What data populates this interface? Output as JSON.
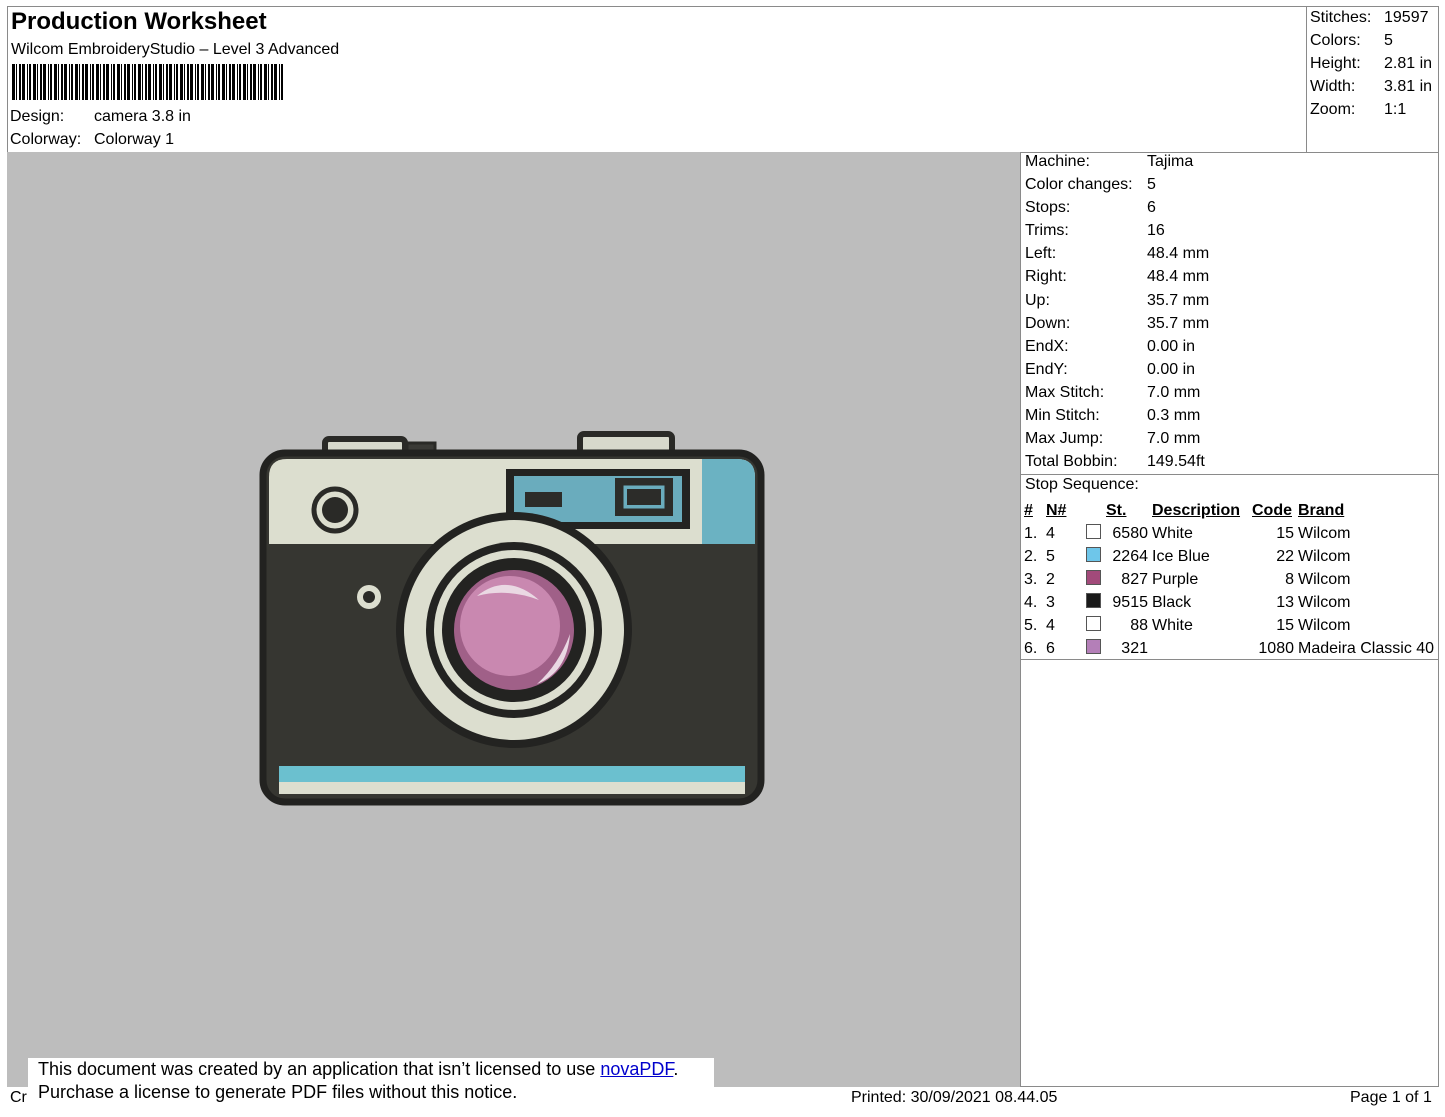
{
  "header": {
    "title": "Production Worksheet",
    "software": "Wilcom EmbroideryStudio – Level 3 Advanced",
    "design_label": "Design:",
    "design_value": "camera 3.8 in",
    "colorway_label": "Colorway:",
    "colorway_value": "Colorway 1"
  },
  "stats": [
    {
      "label": "Stitches:",
      "value": "19597"
    },
    {
      "label": "Colors:",
      "value": "5"
    },
    {
      "label": "Height:",
      "value": "2.81 in"
    },
    {
      "label": "Width:",
      "value": "3.81 in"
    },
    {
      "label": "Zoom:",
      "value": "1:1"
    }
  ],
  "specs": [
    {
      "label": "Machine:",
      "value": "Tajima"
    },
    {
      "label": "Color changes:",
      "value": "5"
    },
    {
      "label": "Stops:",
      "value": "6"
    },
    {
      "label": "Trims:",
      "value": "16"
    },
    {
      "label": "Left:",
      "value": "48.4 mm"
    },
    {
      "label": "Right:",
      "value": "48.4 mm"
    },
    {
      "label": "Up:",
      "value": "35.7 mm"
    },
    {
      "label": "Down:",
      "value": "35.7 mm"
    },
    {
      "label": "EndX:",
      "value": "0.00 in"
    },
    {
      "label": "EndY:",
      "value": "0.00 in"
    },
    {
      "label": "Max Stitch:",
      "value": "7.0 mm"
    },
    {
      "label": "Min Stitch:",
      "value": "0.3 mm"
    },
    {
      "label": "Max Jump:",
      "value": "7.0 mm"
    },
    {
      "label": "Total Bobbin:",
      "value": "149.54ft"
    }
  ],
  "stop_sequence": {
    "title": "Stop Sequence:",
    "headers": {
      "num": "#",
      "needle": "N#",
      "stitches": "St.",
      "description": "Description",
      "code": "Code",
      "brand": "Brand"
    },
    "rows": [
      {
        "num": "1.",
        "needle": "4",
        "color": "#ffffff",
        "stitches": "6580",
        "description": "White",
        "code": "15",
        "brand": "Wilcom"
      },
      {
        "num": "2.",
        "needle": "5",
        "color": "#6ec6ea",
        "stitches": "2264",
        "description": "Ice Blue",
        "code": "22",
        "brand": "Wilcom"
      },
      {
        "num": "3.",
        "needle": "2",
        "color": "#a24a7a",
        "stitches": "827",
        "description": "Purple",
        "code": "8",
        "brand": "Wilcom"
      },
      {
        "num": "4.",
        "needle": "3",
        "color": "#1a1a1a",
        "stitches": "9515",
        "description": "Black",
        "code": "13",
        "brand": "Wilcom"
      },
      {
        "num": "5.",
        "needle": "4",
        "color": "#ffffff",
        "stitches": "88",
        "description": "White",
        "code": "15",
        "brand": "Wilcom"
      },
      {
        "num": "6.",
        "needle": "6",
        "color": "#b47fb8",
        "stitches": "321",
        "description": "",
        "code": "1080",
        "brand": "Madeira Classic 40"
      }
    ]
  },
  "notice": {
    "line1_prefix": "This document was created by an application that isn’t licensed to use ",
    "link": "novaPDF",
    "line1_suffix": ".",
    "line2": "Purchase a license to generate PDF files without this notice."
  },
  "footer": {
    "left_fragment": "Cr",
    "printed": "Printed: 30/09/2021 08.44.05",
    "page": "Page 1 of 1"
  }
}
